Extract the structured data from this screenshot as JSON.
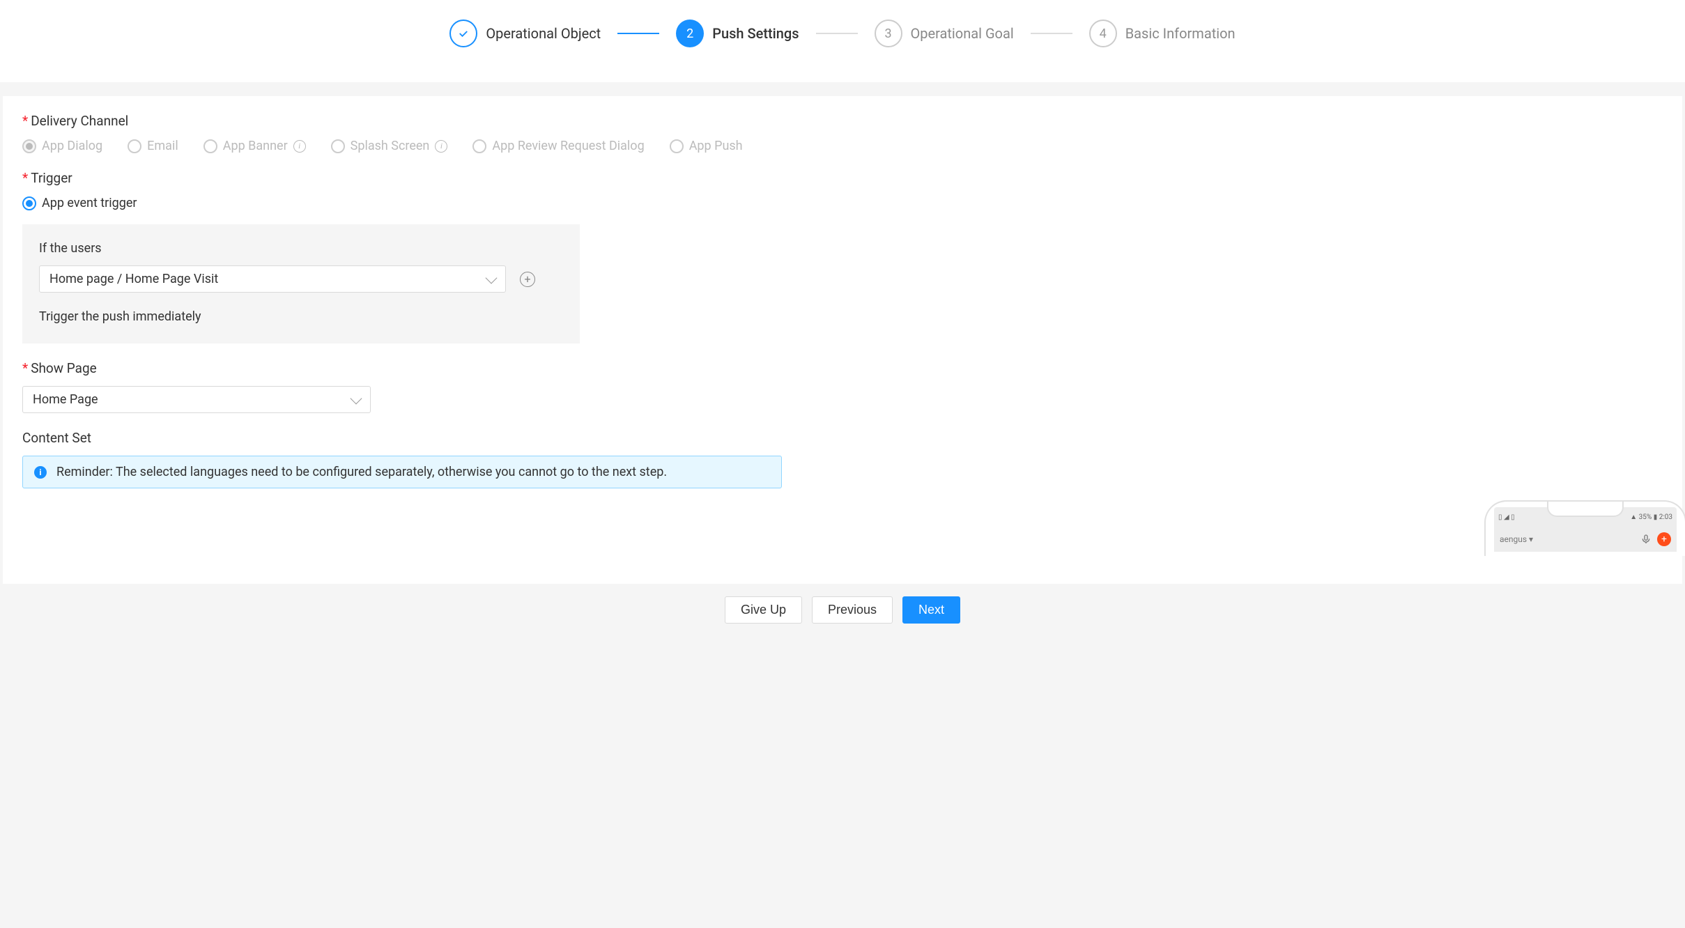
{
  "steps": {
    "s1": {
      "label": "Operational Object"
    },
    "s2": {
      "num": "2",
      "label": "Push Settings"
    },
    "s3": {
      "num": "3",
      "label": "Operational Goal"
    },
    "s4": {
      "num": "4",
      "label": "Basic Information"
    }
  },
  "form": {
    "delivery_channel": {
      "label": "Delivery Channel",
      "opts": {
        "app_dialog": "App Dialog",
        "email": "Email",
        "app_banner": "App Banner",
        "splash": "Splash Screen",
        "review": "App Review Request Dialog",
        "app_push": "App Push"
      }
    },
    "trigger": {
      "label": "Trigger",
      "opt": "App event trigger",
      "if_users": "If the users",
      "event_value": "Home page / Home Page Visit",
      "note": "Trigger the push immediately"
    },
    "show_page": {
      "label": "Show Page",
      "value": "Home Page"
    },
    "content_set": {
      "label": "Content Set",
      "alert": "Reminder: The selected languages need to be configured separately, otherwise you cannot go to the next step."
    }
  },
  "preview": {
    "status_left": "▯ ◢ ▯",
    "status_right": "▲ 35% ▮ 2:03",
    "app_name": "aengus ▾"
  },
  "buttons": {
    "giveup": "Give Up",
    "prev": "Previous",
    "next": "Next"
  }
}
